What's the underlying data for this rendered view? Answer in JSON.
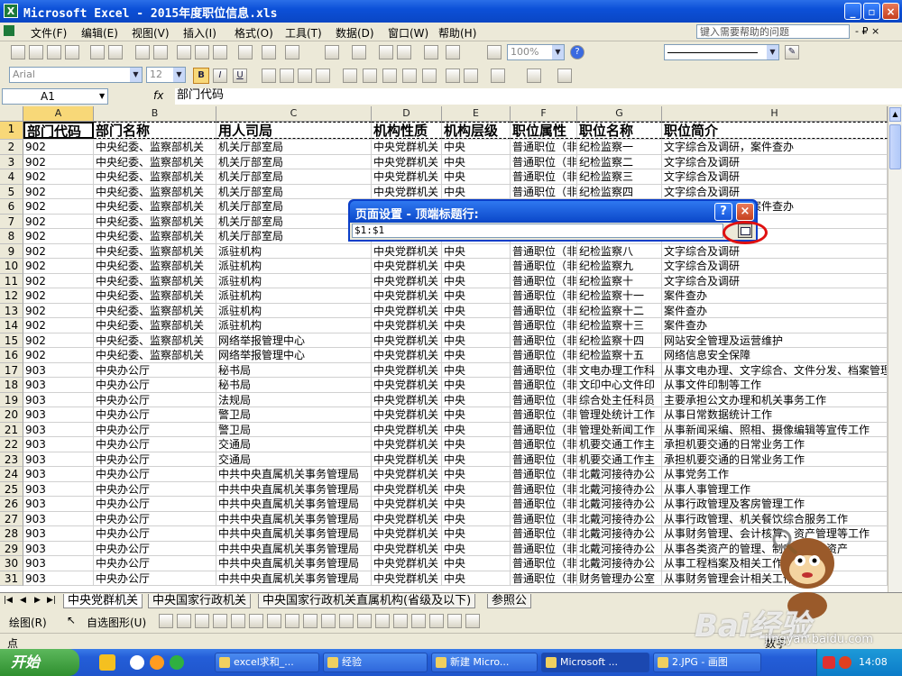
{
  "window": {
    "title": "Microsoft Excel - 2015年度职位信息.xls",
    "app_icon": "X"
  },
  "menu": {
    "items": [
      "文件(F)",
      "编辑(E)",
      "视图(V)",
      "插入(I)",
      "格式(O)",
      "工具(T)",
      "数据(D)",
      "窗口(W)",
      "帮助(H)"
    ],
    "help_placeholder": "键入需要帮助的问题",
    "right_controls": "- ₽ ×"
  },
  "toolbar": {
    "zoom": "100%",
    "font_name": "Arial",
    "font_size": "12",
    "bold": "B",
    "italic": "I",
    "underline": "U"
  },
  "formula_bar": {
    "name_box": "A1",
    "fx": "fx",
    "content": "部门代码"
  },
  "columns": [
    "A",
    "B",
    "C",
    "D",
    "E",
    "F",
    "G",
    "H"
  ],
  "header_row": [
    "部门代码",
    "部门名称",
    "用人司局",
    "机构性质",
    "机构层级",
    "职位属性",
    "职位名称",
    "职位简介"
  ],
  "rows": [
    [
      "902",
      "中央纪委、监察部机关",
      "机关厅部室局",
      "中央党群机关",
      "中央",
      "普通职位（非",
      "纪检监察一",
      "文字综合及调研，案件查办"
    ],
    [
      "902",
      "中央纪委、监察部机关",
      "机关厅部室局",
      "中央党群机关",
      "中央",
      "普通职位（非",
      "纪检监察二",
      "文字综合及调研"
    ],
    [
      "902",
      "中央纪委、监察部机关",
      "机关厅部室局",
      "中央党群机关",
      "中央",
      "普通职位（非",
      "纪检监察三",
      "文字综合及调研"
    ],
    [
      "902",
      "中央纪委、监察部机关",
      "机关厅部室局",
      "中央党群机关",
      "中央",
      "普通职位（非",
      "纪检监察四",
      "文字综合及调研"
    ],
    [
      "902",
      "中央纪委、监察部机关",
      "机关厅部室局",
      "中央党群机关",
      "中央",
      "普通职位（非",
      "纪检监察五",
      "文字综合及调研，案件查办"
    ],
    [
      "902",
      "中央纪委、监察部机关",
      "机关厅部室局",
      "中央党群机关",
      "中央",
      "普通职位（非",
      "纪检监察六",
      "文字综合及调研"
    ],
    [
      "902",
      "中央纪委、监察部机关",
      "机关厅部室局",
      "中央党群机关",
      "中央",
      "普通职位（非",
      "纪检监察七",
      "文字综合及调研"
    ],
    [
      "902",
      "中央纪委、监察部机关",
      "派驻机构",
      "中央党群机关",
      "中央",
      "普通职位（非",
      "纪检监察八",
      "文字综合及调研"
    ],
    [
      "902",
      "中央纪委、监察部机关",
      "派驻机构",
      "中央党群机关",
      "中央",
      "普通职位（非",
      "纪检监察九",
      "文字综合及调研"
    ],
    [
      "902",
      "中央纪委、监察部机关",
      "派驻机构",
      "中央党群机关",
      "中央",
      "普通职位（非",
      "纪检监察十",
      "文字综合及调研"
    ],
    [
      "902",
      "中央纪委、监察部机关",
      "派驻机构",
      "中央党群机关",
      "中央",
      "普通职位（非",
      "纪检监察十一",
      "案件查办"
    ],
    [
      "902",
      "中央纪委、监察部机关",
      "派驻机构",
      "中央党群机关",
      "中央",
      "普通职位（非",
      "纪检监察十二",
      "案件查办"
    ],
    [
      "902",
      "中央纪委、监察部机关",
      "派驻机构",
      "中央党群机关",
      "中央",
      "普通职位（非",
      "纪检监察十三",
      "案件查办"
    ],
    [
      "902",
      "中央纪委、监察部机关",
      "网络举报管理中心",
      "中央党群机关",
      "中央",
      "普通职位（非",
      "纪检监察十四",
      "网站安全管理及运营维护"
    ],
    [
      "902",
      "中央纪委、监察部机关",
      "网络举报管理中心",
      "中央党群机关",
      "中央",
      "普通职位（非",
      "纪检监察十五",
      "网络信息安全保障"
    ],
    [
      "903",
      "中央办公厅",
      "秘书局",
      "中央党群机关",
      "中央",
      "普通职位（非",
      "文电办理工作科",
      "从事文电办理、文字综合、文件分发、档案管理"
    ],
    [
      "903",
      "中央办公厅",
      "秘书局",
      "中央党群机关",
      "中央",
      "普通职位（非",
      "文印中心文件印",
      "从事文件印制等工作"
    ],
    [
      "903",
      "中央办公厅",
      "法规局",
      "中央党群机关",
      "中央",
      "普通职位（非",
      "综合处主任科员",
      "主要承担公文办理和机关事务工作"
    ],
    [
      "903",
      "中央办公厅",
      "警卫局",
      "中央党群机关",
      "中央",
      "普通职位（非",
      "管理处统计工作",
      "从事日常数据统计工作"
    ],
    [
      "903",
      "中央办公厅",
      "警卫局",
      "中央党群机关",
      "中央",
      "普通职位（非",
      "管理处新闻工作",
      "从事新闻采编、照相、摄像编辑等宣传工作"
    ],
    [
      "903",
      "中央办公厅",
      "交通局",
      "中央党群机关",
      "中央",
      "普通职位（非",
      "机要交通工作主",
      "承担机要交通的日常业务工作"
    ],
    [
      "903",
      "中央办公厅",
      "交通局",
      "中央党群机关",
      "中央",
      "普通职位（非",
      "机要交通工作主",
      "承担机要交通的日常业务工作"
    ],
    [
      "903",
      "中央办公厅",
      "中共中央直属机关事务管理局",
      "中央党群机关",
      "中央",
      "普通职位（非",
      "北戴河接待办公",
      "从事党务工作"
    ],
    [
      "903",
      "中央办公厅",
      "中共中央直属机关事务管理局",
      "中央党群机关",
      "中央",
      "普通职位（非",
      "北戴河接待办公",
      "从事人事管理工作"
    ],
    [
      "903",
      "中央办公厅",
      "中共中央直属机关事务管理局",
      "中央党群机关",
      "中央",
      "普通职位（非",
      "北戴河接待办公",
      "从事行政管理及客房管理工作"
    ],
    [
      "903",
      "中央办公厅",
      "中共中央直属机关事务管理局",
      "中央党群机关",
      "中央",
      "普通职位（非",
      "北戴河接待办公",
      "从事行政管理、机关餐饮综合服务工作"
    ],
    [
      "903",
      "中央办公厅",
      "中共中央直属机关事务管理局",
      "中央党群机关",
      "中央",
      "普通职位（非",
      "北戴河接待办公",
      "从事财务管理、会计核算、资产管理等工作"
    ],
    [
      "903",
      "中央办公厅",
      "中共中央直属机关事务管理局",
      "中央党群机关",
      "中央",
      "普通职位（非",
      "北戴河接待办公",
      "从事各类资产的管理、制度及固定资产"
    ],
    [
      "903",
      "中央办公厅",
      "中共中央直属机关事务管理局",
      "中央党群机关",
      "中央",
      "普通职位（非",
      "北戴河接待办公",
      "从事工程档案及相关工作"
    ],
    [
      "903",
      "中央办公厅",
      "中共中央直属机关事务管理局",
      "中央党群机关",
      "中央",
      "普通职位（非",
      "财务管理办公室",
      "从事财务管理会计相关工作"
    ]
  ],
  "sheet_tabs": [
    "中央党群机关",
    "中央国家行政机关",
    "中央国家行政机关直属机构(省级及以下)",
    "参照公"
  ],
  "drawing_toolbar": {
    "draw": "绘图(R)",
    "autoshapes": "自选图形(U)"
  },
  "status": {
    "left": "点",
    "right": "数字"
  },
  "dialog": {
    "title": "页面设置 - 顶端标题行:",
    "value": "$1:$1",
    "help": "?",
    "close": "×"
  },
  "taskbar": {
    "start": "开始",
    "tasks": [
      "excel求和_...",
      "经验",
      "新建 Micro...",
      "Microsoft ...",
      "2.JPG - 画图"
    ],
    "clock": "14:08"
  },
  "watermark": {
    "brand": "Bai经验",
    "url": "jingyan.baidu.com"
  }
}
